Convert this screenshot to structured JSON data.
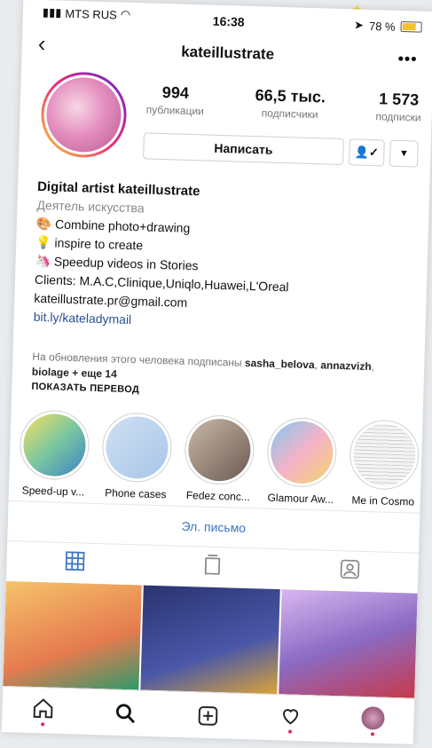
{
  "status": {
    "carrier": "MTS RUS",
    "time": "16:38",
    "battery": "78 %"
  },
  "header": {
    "username": "kateillustrate"
  },
  "stats": [
    {
      "value": "994",
      "label": "публикации"
    },
    {
      "value": "66,5 тыс.",
      "label": "подписчики"
    },
    {
      "value": "1 573",
      "label": "подписки"
    }
  ],
  "actions": {
    "message": "Написать"
  },
  "bio": {
    "name": "Digital artist kateillustrate",
    "category": "Деятель искусства",
    "line1": "Combine photo+drawing",
    "line2": "inspire to create",
    "line3": "Speedup videos in Stories",
    "line4": "Clients: M.A.C,Clinique,Uniqlo,Huawei,L'Oreal",
    "line5": "kateillustrate.pr@gmail.com",
    "link": "bit.ly/kateladymail"
  },
  "followed_by": {
    "prefix": "На обновления этого человека подписаны",
    "user1": "sasha_belova",
    "sep": ",",
    "user2": "annazvizh",
    "sep2": ",",
    "user3": "biolage",
    "more": "+ еще 14"
  },
  "translate": "ПОКАЗАТЬ ПЕРЕВОД",
  "highlights": [
    {
      "caption": "Speed-up v...",
      "color": "#7ac7a0"
    },
    {
      "caption": "Phone cases",
      "color": "#a8c6e8"
    },
    {
      "caption": "Fedez conc...",
      "color": "#6b5a52"
    },
    {
      "caption": "Glamour Aw...",
      "color": "#f5b3c8"
    },
    {
      "caption": "Me in Cosmo",
      "color": "#e9e9e9"
    }
  ],
  "email_button": "Эл. письмо",
  "grid_colors": [
    "#e57b4f",
    "#4a57a8",
    "#8b6bc4"
  ]
}
